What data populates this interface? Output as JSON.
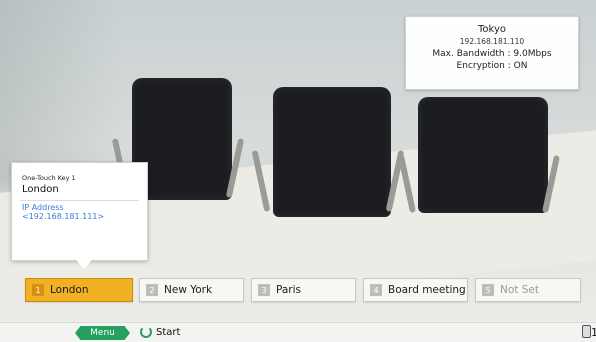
{
  "remote_site": {
    "name": "Tokyo",
    "ip": "192.168.181.110",
    "bandwidth": "Max. Bandwidth : 9.0Mbps",
    "encryption": "Encryption : ON"
  },
  "popup": {
    "key_label": "One-Touch Key 1",
    "name": "London",
    "ip_label": "IP Address",
    "ip_value": "<192.168.181.111>"
  },
  "one_touch_keys": [
    {
      "num": "1",
      "label": "London",
      "selected": true
    },
    {
      "num": "2",
      "label": "New York",
      "selected": false
    },
    {
      "num": "3",
      "label": "Paris",
      "selected": false
    },
    {
      "num": "4",
      "label": "Board meeting",
      "selected": false
    },
    {
      "num": "5",
      "label": "Not Set",
      "selected": false,
      "disabled": true
    }
  ],
  "bottom_bar": {
    "menu_label": "Menu",
    "start_label": "Start",
    "right_indicator": "1"
  },
  "colors": {
    "selected_key": "#f2b023",
    "menu_button": "#25a05f",
    "ip_text": "#3a7cd6"
  },
  "icons": {
    "start": "start-icon",
    "device": "remote-icon"
  }
}
